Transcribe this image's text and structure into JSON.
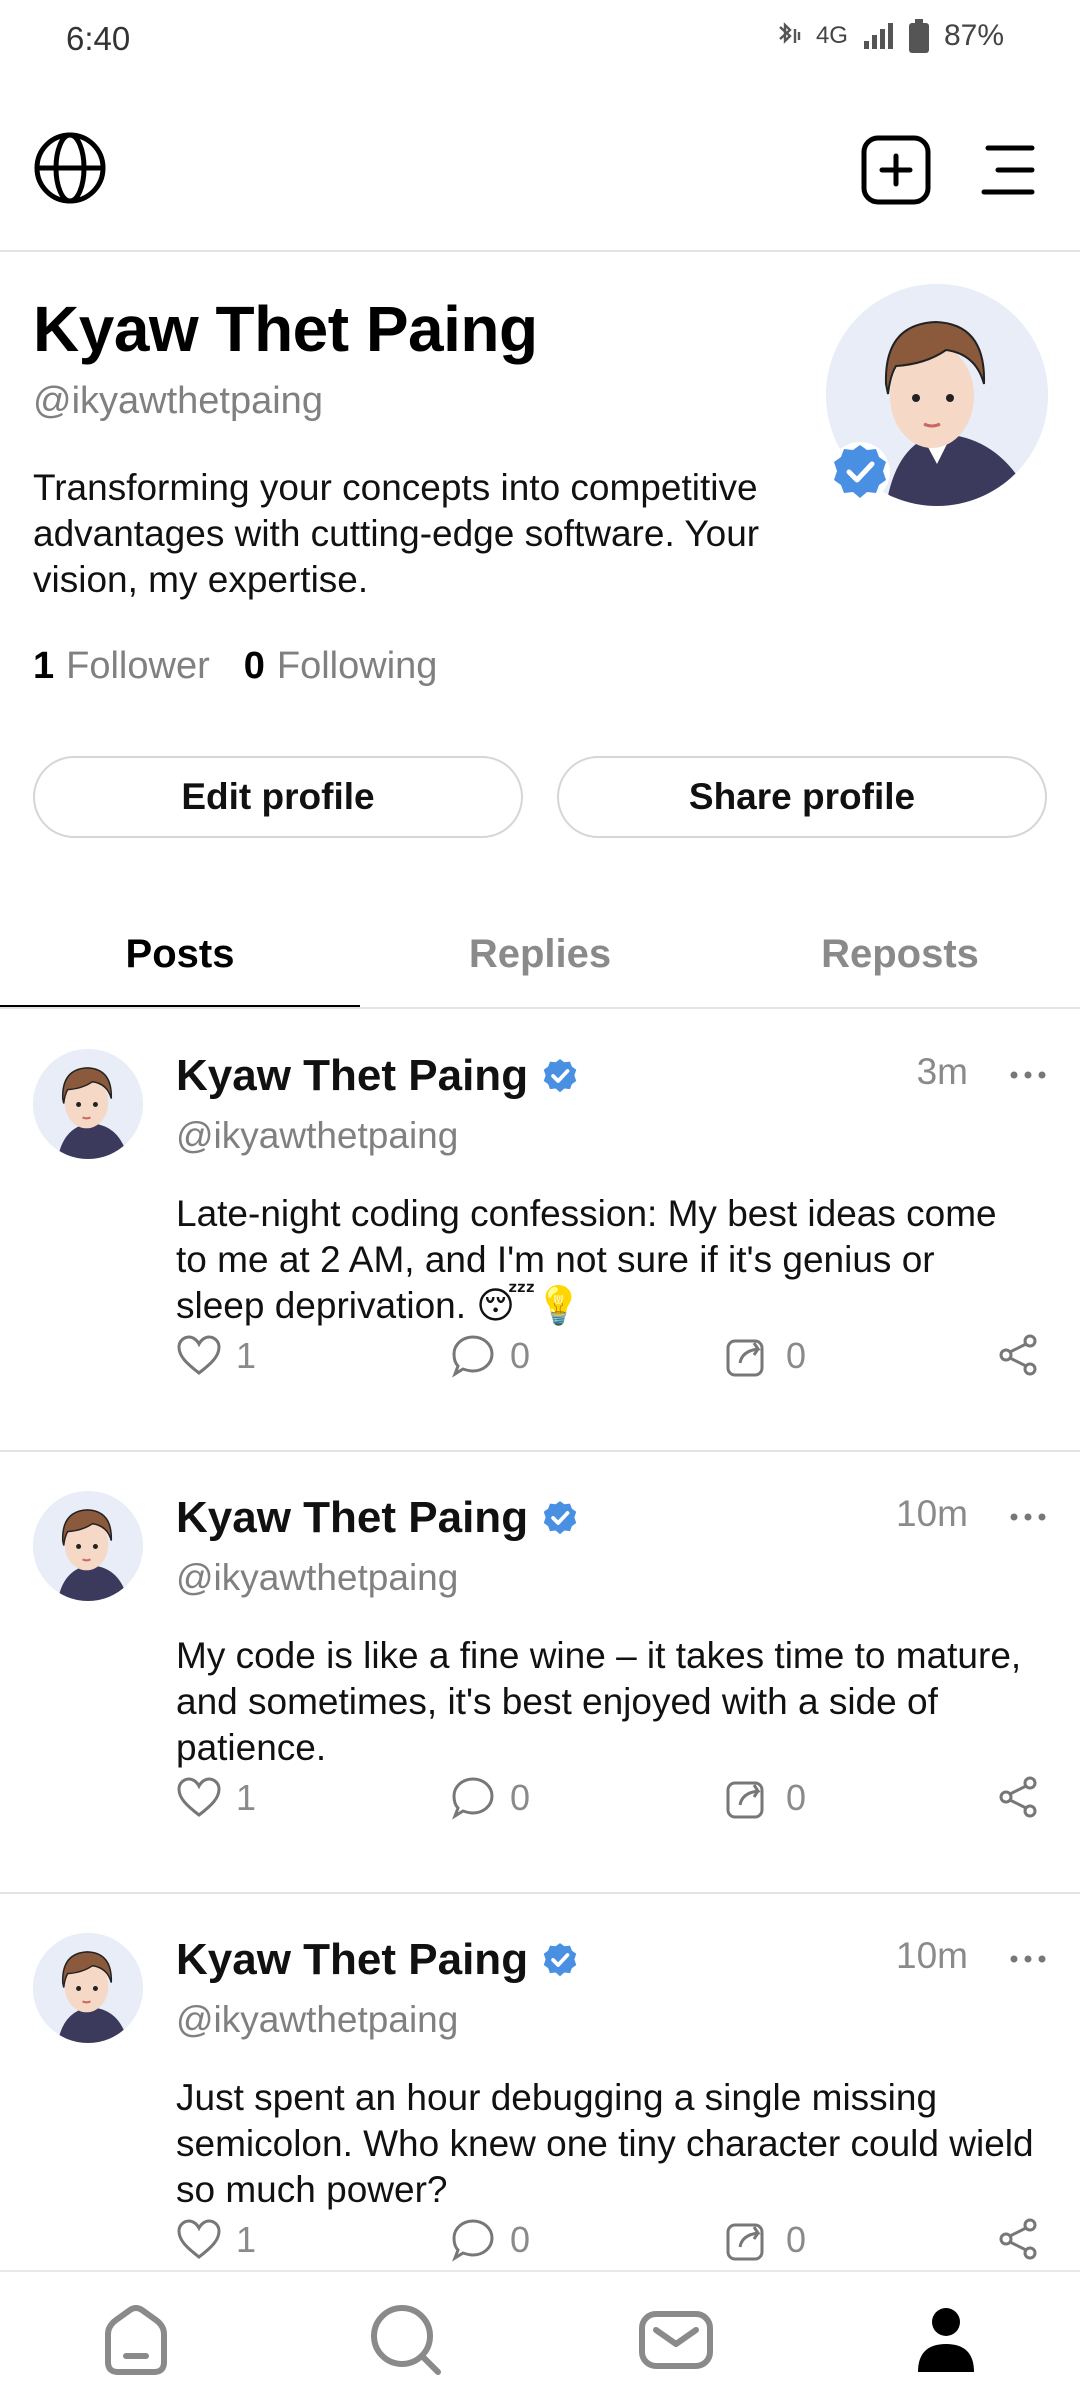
{
  "status_bar": {
    "time": "6:40",
    "network": "4G",
    "battery": "87%"
  },
  "top_bar": {
    "globe_icon": "globe-icon",
    "new_post_icon": "plus-square-icon",
    "menu_icon": "menu-icon"
  },
  "profile": {
    "name": "Kyaw Thet Paing",
    "handle": "@ikyawthetpaing",
    "bio": "Transforming your concepts into competitive advantages with cutting-edge software. Your vision, my expertise.",
    "followers_count": "1",
    "followers_label": "Follower",
    "following_count": "0",
    "following_label": "Following",
    "edit_label": "Edit profile",
    "share_label": "Share profile"
  },
  "tabs": [
    {
      "label": "Posts",
      "active": true
    },
    {
      "label": "Replies",
      "active": false
    },
    {
      "label": "Reposts",
      "active": false
    }
  ],
  "posts": [
    {
      "name": "Kyaw Thet Paing",
      "handle": "@ikyawthetpaing",
      "time": "3m",
      "text": "Late-night coding confession: My best ideas come\nto me at 2 AM, and I'm not sure if it's genius or\nsleep deprivation. 😴💡",
      "likes": "1",
      "comments": "0",
      "reposts": "0"
    },
    {
      "name": "Kyaw Thet Paing",
      "handle": "@ikyawthetpaing",
      "time": "10m",
      "text": "My code is like a fine wine – it takes time to mature,\nand sometimes, it's best enjoyed with a side of\npatience.",
      "likes": "1",
      "comments": "0",
      "reposts": "0"
    },
    {
      "name": "Kyaw Thet Paing",
      "handle": "@ikyawthetpaing",
      "time": "10m",
      "text": "Just spent an hour debugging a single missing\nsemicolon. Who knew one tiny character could wield\nso much power?",
      "likes": "1",
      "comments": "0",
      "reposts": "0"
    }
  ],
  "colors": {
    "verified": "#4a90e2",
    "muted": "#808080",
    "divider": "#e4e4e4"
  }
}
